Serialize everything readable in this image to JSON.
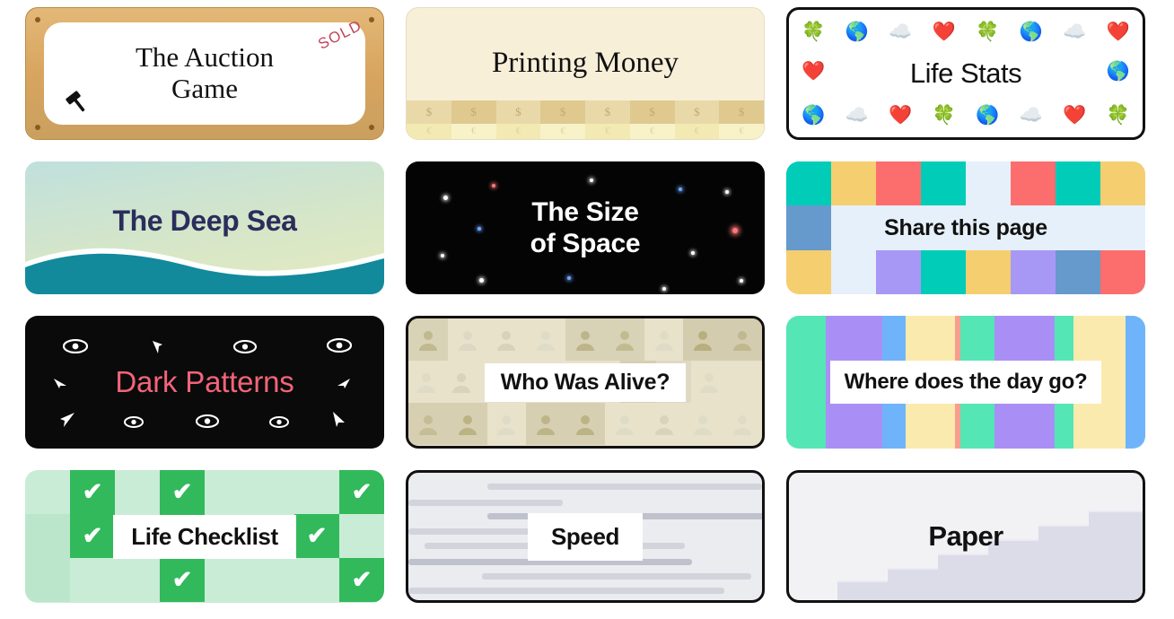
{
  "cards": [
    {
      "id": "auction-game",
      "title": "The Auction\nGame",
      "title_line1": "The Auction",
      "title_line2": "Game",
      "stamp": "SOLD",
      "icon": "gavel-icon",
      "colors": {
        "frame": "#d9a962",
        "panel": "#ffffff",
        "stamp": "#c4445a",
        "dot": "#8a5a1e"
      }
    },
    {
      "id": "printing-money",
      "title": "Printing Money",
      "currency_row_1": [
        "$",
        "$",
        "$",
        "$",
        "$",
        "$",
        "$",
        "$"
      ],
      "currency_row_2": [
        "€",
        "€",
        "€",
        "€",
        "€",
        "€",
        "€",
        "€"
      ],
      "colors": {
        "bg": "#f7efd8",
        "band1": "#e9d9a9",
        "band1_alt": "#dfc98f",
        "band2": "#f2eab2",
        "band2_alt": "#f7f2c8"
      }
    },
    {
      "id": "life-stats",
      "title": "Life Stats",
      "emoji_row_1": [
        "🍀",
        "🌎",
        "☁️",
        "❤️",
        "🍀",
        "🌎",
        "☁️",
        "❤️"
      ],
      "emoji_row_2": [
        "❤️",
        "🌎"
      ],
      "emoji_row_3": [
        "🌎",
        "☁️",
        "❤️",
        "🍀",
        "🌎",
        "☁️",
        "❤️",
        "🍀"
      ],
      "colors": {
        "bg": "#ffffff",
        "border": "#111111"
      }
    },
    {
      "id": "deep-sea",
      "title": "The Deep Sea",
      "colors": {
        "gradient_top": "#bfe0dd",
        "gradient_mid": "#d6e6c8",
        "gradient_bottom": "#e6ecc0",
        "wave": "#128a9c",
        "crest": "#ffffff",
        "text": "#2b2d5c"
      }
    },
    {
      "id": "size-of-space",
      "title": "The Size of Space",
      "title_line1": "The Size",
      "title_line2": "of Space",
      "colors": {
        "bg": "#040404",
        "text": "#ffffff",
        "star_white": "#ffffff",
        "star_blue": "#6fa8ff",
        "star_red": "#ff7878"
      }
    },
    {
      "id": "share-this-page",
      "title": "Share this page",
      "colors": {
        "bg": "#e5f0fa",
        "teal": "#00ccb8",
        "yellow": "#f5ce70",
        "red": "#fc6e6e",
        "blue": "#6699cc",
        "purple": "#a898f5"
      }
    },
    {
      "id": "dark-patterns",
      "title": "Dark Patterns",
      "icons": [
        "eye-icon",
        "cursor-arrow-icon"
      ],
      "colors": {
        "bg": "#0a0a0a",
        "text": "#f2647a",
        "icon": "#ffffff"
      }
    },
    {
      "id": "who-was-alive",
      "title": "Who Was Alive?",
      "icon": "person-silhouette-icon",
      "colors": {
        "bg": "#e8e2cb",
        "border": "#111111",
        "person_light": "#dedbc6",
        "person_dark": "#b3ab81",
        "banner": "#ffffff"
      }
    },
    {
      "id": "where-does-the-day-go",
      "title": "Where does the day go?",
      "colors": {
        "mint": "#54e6b5",
        "purple": "#a98ff5",
        "blue": "#6fb4fa",
        "yellow": "#fbeaae",
        "salmon": "#f99e8e",
        "banner": "#ffffff"
      }
    },
    {
      "id": "life-checklist",
      "title": "Life Checklist",
      "check_glyph": "✔",
      "colors": {
        "bg": "#c9ecd6",
        "pale": "#bbe6cb",
        "check_box": "#32b95c",
        "check_mark": "#ffffff",
        "banner": "#ffffff"
      }
    },
    {
      "id": "speed",
      "title": "Speed",
      "colors": {
        "bg": "#ebecf0",
        "border": "#111111",
        "bar_light": "#d2d4dc",
        "bar_dark": "#b6b9c4",
        "banner": "#ffffff"
      }
    },
    {
      "id": "paper",
      "title": "Paper",
      "colors": {
        "bg": "#f2f2f5",
        "border": "#111111",
        "sheet": "#dcdce8",
        "sheet_edge": "#eceaf3"
      }
    }
  ]
}
